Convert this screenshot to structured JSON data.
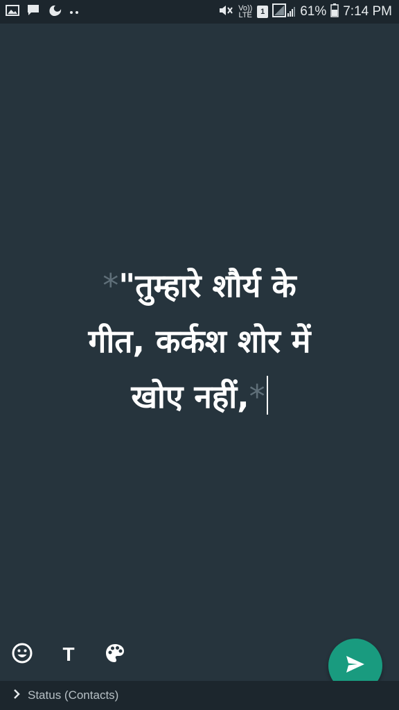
{
  "status_bar": {
    "icons_left": [
      "gallery-icon",
      "message-icon",
      "uc-browser-icon",
      "more-dots-icon"
    ],
    "icons_right": [
      "mute-icon",
      "volte-icon",
      "sim-1-icon",
      "signal-icon"
    ],
    "volte_label": "Vo)) LTE",
    "sim_label": "1",
    "battery": "61%",
    "time": "7:14 PM"
  },
  "editor": {
    "marker_open": "*",
    "line1": "\"तुम्हारे शौर्य के",
    "line2": "गीत, कर्कश शोर में",
    "line3": "खोए नहीं,",
    "marker_close": "*"
  },
  "toolbar": {
    "emoji_icon": "emoji-icon",
    "text_label": "T",
    "palette_icon": "palette-icon"
  },
  "send_button": {
    "icon": "send-icon"
  },
  "bottom_bar": {
    "chevron_icon": "chevron-right-icon",
    "label": "Status (Contacts)"
  },
  "colors": {
    "background": "#26343d",
    "status_bar": "#1c262d",
    "accent": "#199b7f",
    "marker": "#5f6f79",
    "text": "#ffffff"
  }
}
